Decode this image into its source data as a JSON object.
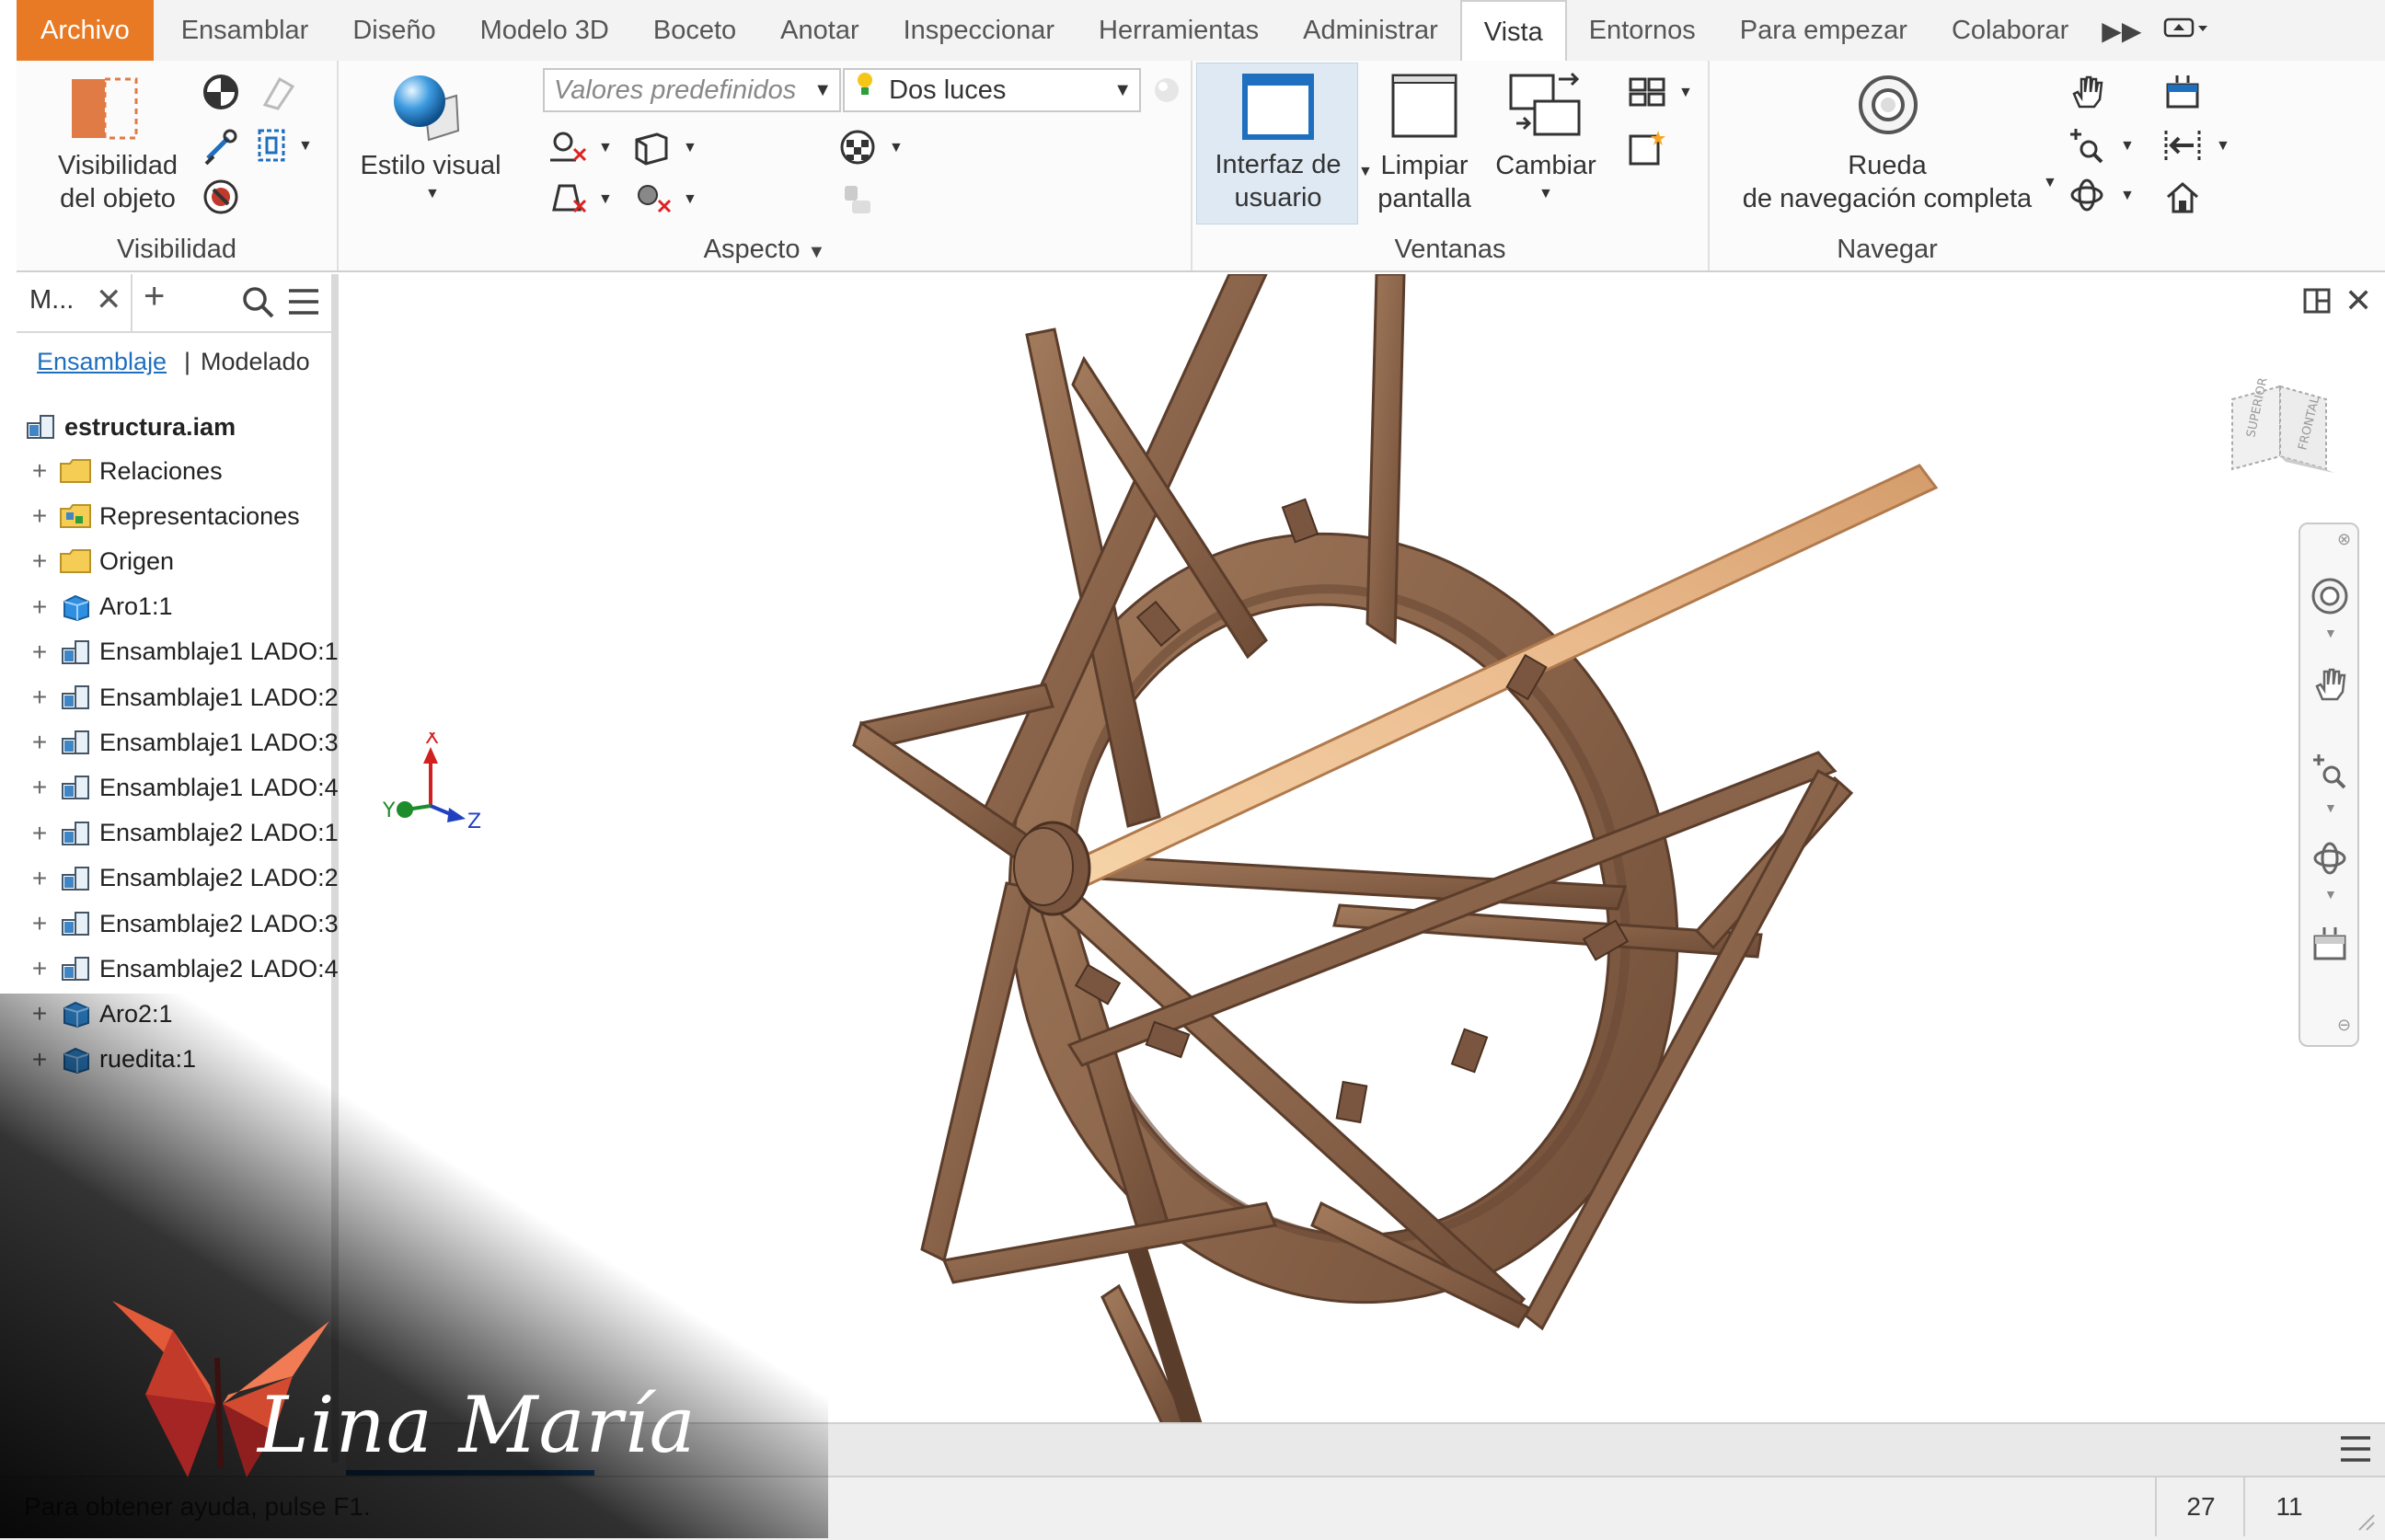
{
  "menu": {
    "tabs": [
      "Archivo",
      "Ensamblar",
      "Diseño",
      "Modelo 3D",
      "Boceto",
      "Anotar",
      "Inspeccionar",
      "Herramientas",
      "Administrar",
      "Vista",
      "Entornos",
      "Para empezar",
      "Colaborar"
    ],
    "active_tab": "Vista",
    "file_color": "#e87a25"
  },
  "ribbon": {
    "visibilidad": {
      "title": "Visibilidad",
      "object_visibility_line1": "Visibilidad",
      "object_visibility_line2": "del objeto"
    },
    "aspecto": {
      "title": "Aspecto",
      "visual_style": "Estilo visual",
      "presets_placeholder": "Valores predefinidos",
      "lighting_value": "Dos luces"
    },
    "ventanas": {
      "title": "Ventanas",
      "ui_line1": "Interfaz de",
      "ui_line2": "usuario",
      "clean_line1": "Limpiar",
      "clean_line2": "pantalla",
      "switch": "Cambiar"
    },
    "navegar": {
      "title": "Navegar",
      "wheel_line1": "Rueda",
      "wheel_line2": "de navegación completa"
    }
  },
  "browser": {
    "title": "M...",
    "tabs": [
      "Ensamblaje",
      "Modelado"
    ],
    "active_tab": "Ensamblaje",
    "root": "estructura.iam",
    "items": [
      {
        "label": "Relaciones",
        "icon": "folder-icon"
      },
      {
        "label": "Representaciones",
        "icon": "representations-folder-icon"
      },
      {
        "label": "Origen",
        "icon": "folder-icon"
      },
      {
        "label": "Aro1:1",
        "icon": "part-icon"
      },
      {
        "label": "Ensamblaje1 LADO:1",
        "icon": "assembly-icon"
      },
      {
        "label": "Ensamblaje1 LADO:2",
        "icon": "assembly-icon"
      },
      {
        "label": "Ensamblaje1 LADO:3",
        "icon": "assembly-icon"
      },
      {
        "label": "Ensamblaje1 LADO:4",
        "icon": "assembly-icon"
      },
      {
        "label": "Ensamblaje2 LADO:1",
        "icon": "assembly-icon"
      },
      {
        "label": "Ensamblaje2 LADO:2",
        "icon": "assembly-icon"
      },
      {
        "label": "Ensamblaje2 LADO:3",
        "icon": "assembly-icon"
      },
      {
        "label": "Ensamblaje2 LADO:4",
        "icon": "assembly-icon"
      },
      {
        "label": "Aro2:1",
        "icon": "part-icon"
      },
      {
        "label": "ruedita:1",
        "icon": "part-icon"
      }
    ]
  },
  "viewcube": {
    "top_label": "SUPERIOR",
    "front_label": "FRONTAL"
  },
  "triad": {
    "x": "X",
    "y": "Y",
    "z": "Z"
  },
  "status": {
    "help": "Para obtener ayuda, pulse F1.",
    "count1": "27",
    "count2": "11"
  },
  "watermark": "Lina María",
  "colors": {
    "wood": "#8a644a",
    "wood_dark": "#5b3d2b",
    "wood_light": "#e8b88b"
  }
}
